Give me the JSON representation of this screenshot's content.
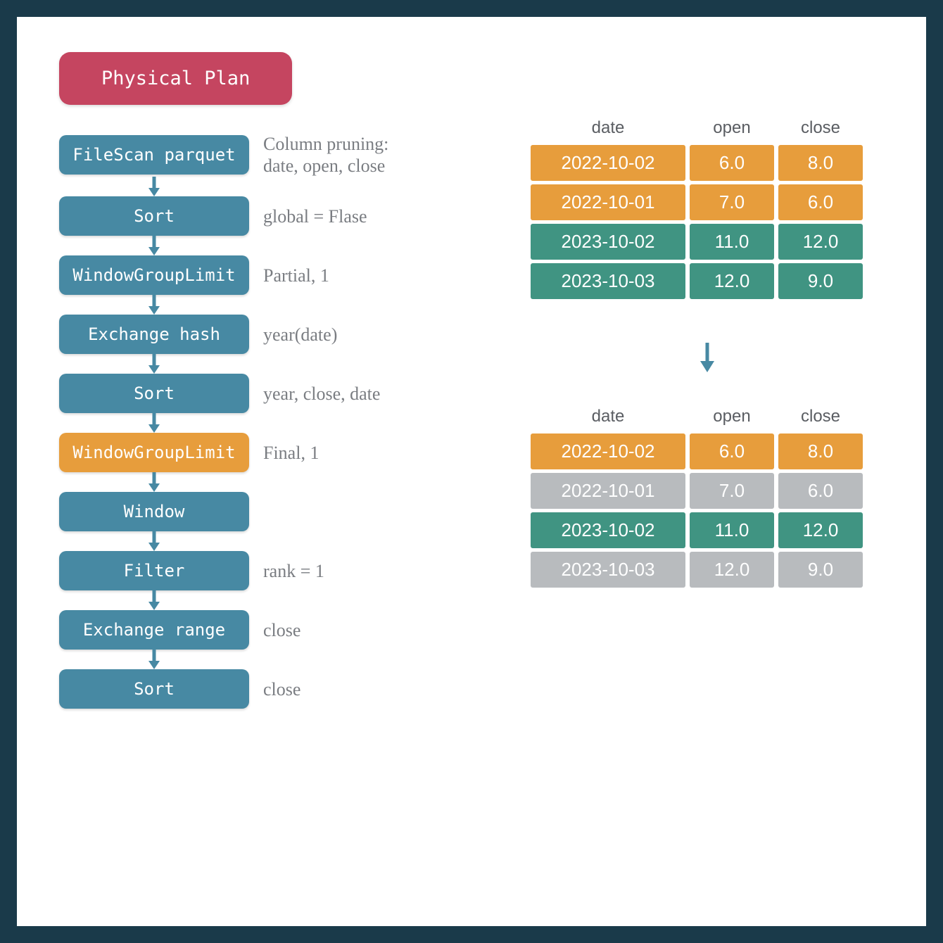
{
  "title": "Physical Plan",
  "plan": [
    {
      "label": "FileScan parquet",
      "note": "Column pruning:\ndate, open, close",
      "highlight": false
    },
    {
      "label": "Sort",
      "note": "global = Flase",
      "highlight": false
    },
    {
      "label": "WindowGroupLimit",
      "note": "Partial, 1",
      "highlight": false
    },
    {
      "label": "Exchange hash",
      "note": "year(date)",
      "highlight": false
    },
    {
      "label": "Sort",
      "note": "year, close, date",
      "highlight": false
    },
    {
      "label": "WindowGroupLimit",
      "note": "Final, 1",
      "highlight": true
    },
    {
      "label": "Window",
      "note": "",
      "highlight": false
    },
    {
      "label": "Filter",
      "note": "rank = 1",
      "highlight": false
    },
    {
      "label": "Exchange range",
      "note": "close",
      "highlight": false
    },
    {
      "label": "Sort",
      "note": "close",
      "highlight": false
    }
  ],
  "columns": [
    "date",
    "open",
    "close"
  ],
  "table1": [
    {
      "date": "2022-10-02",
      "open": "6.0",
      "close": "8.0",
      "color": "orange"
    },
    {
      "date": "2022-10-01",
      "open": "7.0",
      "close": "6.0",
      "color": "orange"
    },
    {
      "date": "2023-10-02",
      "open": "11.0",
      "close": "12.0",
      "color": "teal"
    },
    {
      "date": "2023-10-03",
      "open": "12.0",
      "close": "9.0",
      "color": "teal"
    }
  ],
  "table2": [
    {
      "date": "2022-10-02",
      "open": "6.0",
      "close": "8.0",
      "color": "orange"
    },
    {
      "date": "2022-10-01",
      "open": "7.0",
      "close": "6.0",
      "color": "grey"
    },
    {
      "date": "2023-10-02",
      "open": "11.0",
      "close": "12.0",
      "color": "teal"
    },
    {
      "date": "2023-10-03",
      "open": "12.0",
      "close": "9.0",
      "color": "grey"
    }
  ]
}
